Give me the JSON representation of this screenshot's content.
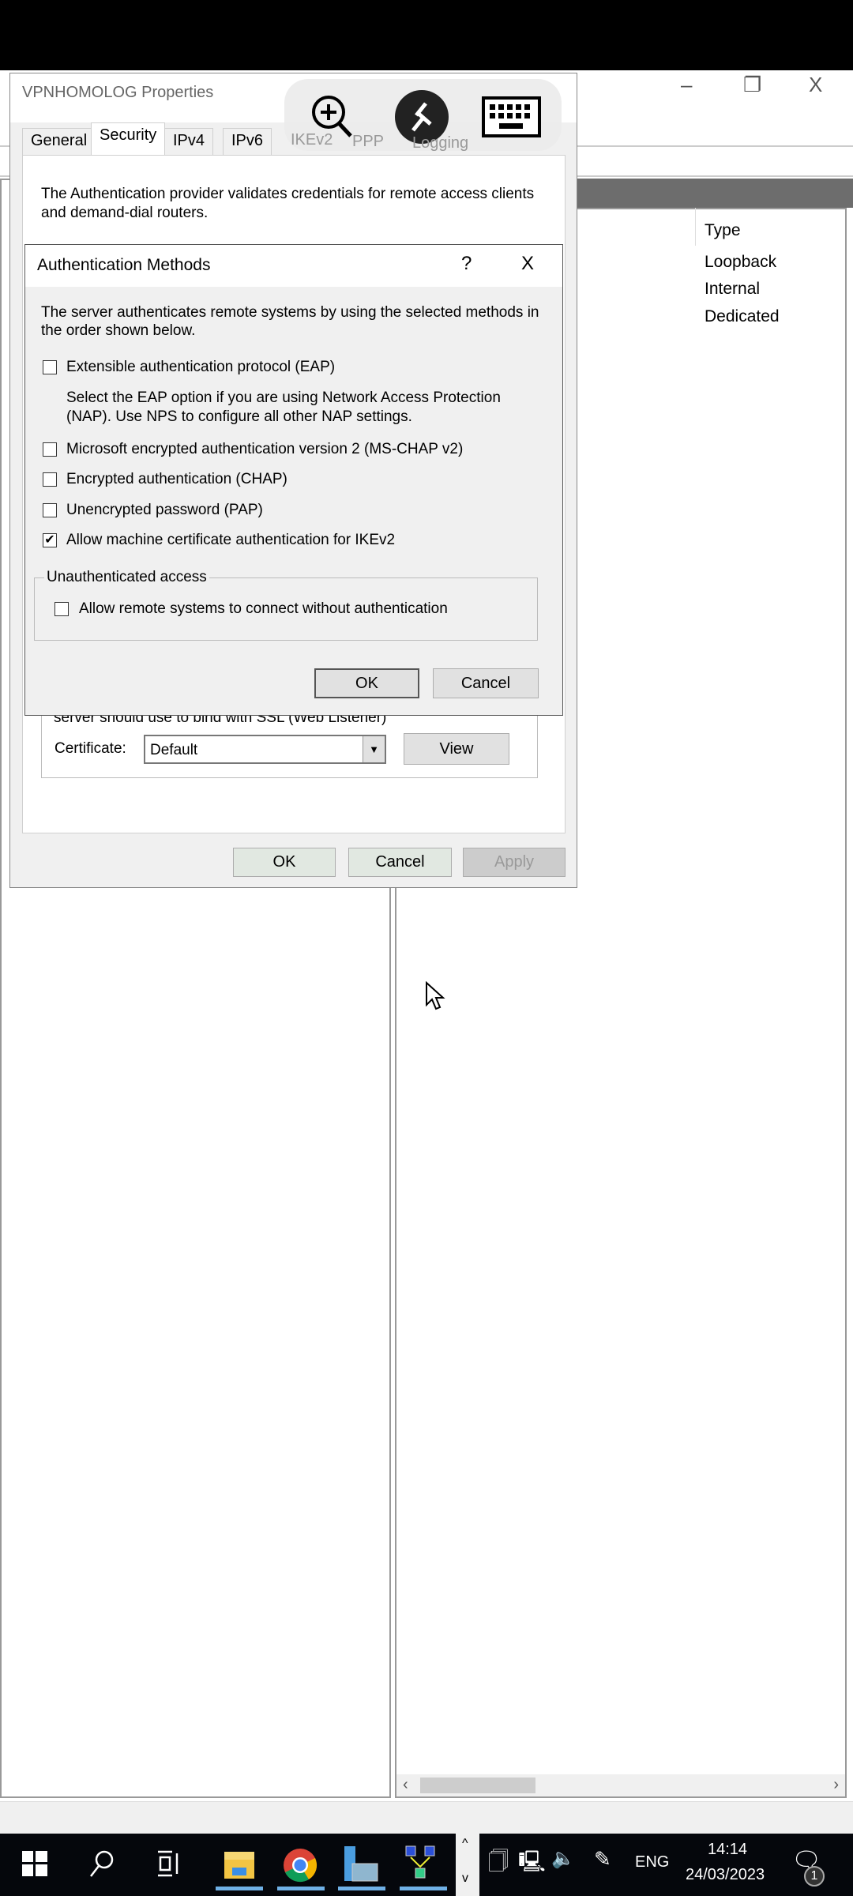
{
  "background_window": {
    "type_column_header": "Type",
    "type_rows": [
      "Loopback",
      "Internal",
      "Dedicated"
    ],
    "controls": {
      "minimize": "–",
      "restore": "❐",
      "close": "X"
    }
  },
  "properties_dialog": {
    "title": "VPNHOMOLOG Properties",
    "tabs": [
      "General",
      "Security",
      "IPv4",
      "IPv6",
      "IKEv2",
      "PPP",
      "Logging"
    ],
    "active_tab": "Security",
    "intro_text": "The Authentication provider validates credentials for remote access clients and demand-dial routers.",
    "ssl_text": "server should use to bind with SSL (Web Listener)",
    "certificate_label": "Certificate:",
    "certificate_value": "Default",
    "view_button": "View",
    "ok_button": "OK",
    "cancel_button": "Cancel",
    "apply_button": "Apply"
  },
  "auth_dialog": {
    "title": "Authentication Methods",
    "help": "?",
    "close": "X",
    "description": "The server authenticates remote systems by using the selected methods in the order shown below.",
    "methods": [
      {
        "label": "Extensible authentication protocol (EAP)",
        "checked": false
      },
      {
        "label": "Microsoft encrypted authentication version 2 (MS-CHAP v2)",
        "checked": false
      },
      {
        "label": "Encrypted authentication (CHAP)",
        "checked": false
      },
      {
        "label": "Unencrypted password (PAP)",
        "checked": false
      },
      {
        "label": "Allow machine certificate authentication for IKEv2",
        "checked": true
      }
    ],
    "eap_note": "Select the EAP option if you are using Network Access Protection (NAP). Use NPS to configure all other NAP settings.",
    "unauth_group": "Unauthenticated access",
    "unauth_label": "Allow remote systems to connect without authentication",
    "unauth_checked": false,
    "ok_button": "OK",
    "cancel_button": "Cancel"
  },
  "rdp_toolbar": {
    "icons": [
      "zoom-in-icon",
      "remote-desktop-icon",
      "keyboard-icon"
    ]
  },
  "taskbar": {
    "language": "ENG",
    "time": "14:14",
    "date": "24/03/2023",
    "notification_count": "1"
  }
}
